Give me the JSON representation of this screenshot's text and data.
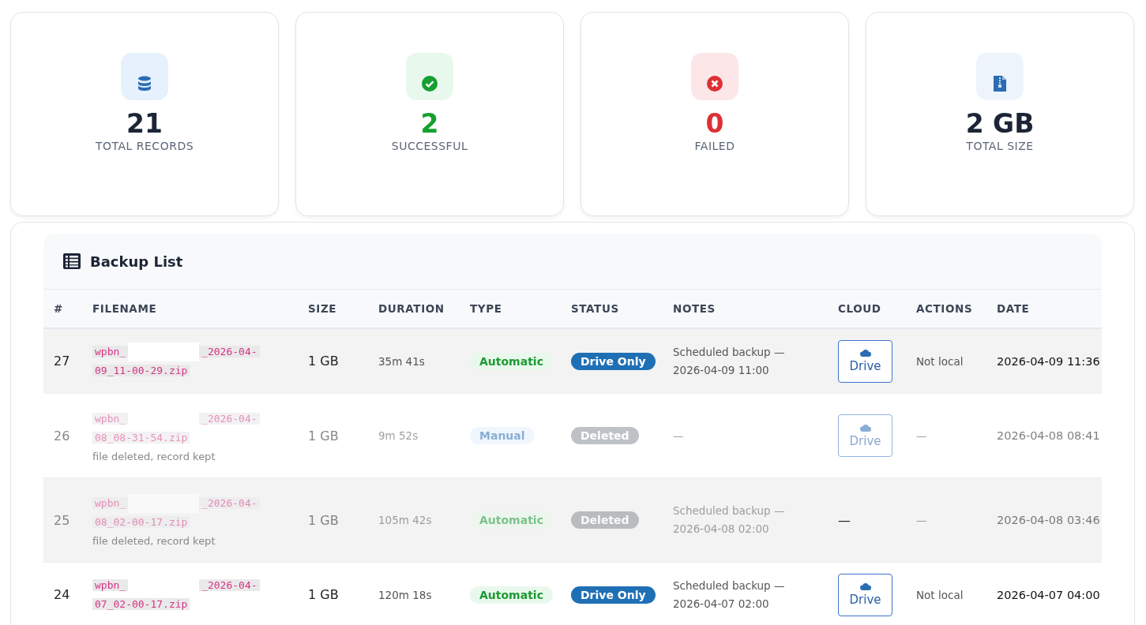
{
  "stats": [
    {
      "kind": "database",
      "value": "21",
      "label": "TOTAL RECORDS"
    },
    {
      "kind": "success",
      "value": "2",
      "label": "SUCCESSFUL"
    },
    {
      "kind": "failure",
      "value": "0",
      "label": "FAILED"
    },
    {
      "kind": "archive",
      "value": "2 GB",
      "label": "TOTAL SIZE"
    }
  ],
  "backup_list": {
    "title": "Backup List",
    "columns": [
      "#",
      "FILENAME",
      "SIZE",
      "DURATION",
      "TYPE",
      "STATUS",
      "NOTES",
      "CLOUD",
      "ACTIONS",
      "DATE"
    ],
    "rows": [
      {
        "number": "27",
        "filename_start": "wpbn_",
        "filename_end": "_2026-04-",
        "filename_line2": "09_11-00-29.zip",
        "deleted": false,
        "size": "1 GB",
        "duration": "35m 41s",
        "type": {
          "kind": "automatic",
          "label": "Automatic"
        },
        "status": {
          "kind": "drive",
          "label": "Drive Only"
        },
        "notes": [
          "Scheduled backup —",
          "2026-04-09 11:00"
        ],
        "cloud": {
          "kind": "drive",
          "label": "Drive"
        },
        "actions": "Not local",
        "date": "2026-04-09 11:36"
      },
      {
        "number": "26",
        "filename_start": "wpbn_",
        "filename_end": "_2026-04-",
        "filename_line2": "08_08-31-54.zip",
        "deleted": true,
        "deleted_note": "file deleted, record kept",
        "size": "1 GB",
        "duration": "9m 52s",
        "type": {
          "kind": "manual",
          "label": "Manual"
        },
        "status": {
          "kind": "deleted",
          "label": "Deleted"
        },
        "notes": [
          "—"
        ],
        "cloud": {
          "kind": "drive",
          "label": "Drive"
        },
        "actions": "—",
        "date": "2026-04-08 08:41"
      },
      {
        "number": "25",
        "filename_start": "wpbn_",
        "filename_end": "_2026-04-",
        "filename_line2": "08_02-00-17.zip",
        "deleted": true,
        "deleted_note": "file deleted, record kept",
        "size": "1 GB",
        "duration": "105m 42s",
        "type": {
          "kind": "automatic",
          "label": "Automatic"
        },
        "status": {
          "kind": "deleted",
          "label": "Deleted"
        },
        "notes": [
          "Scheduled backup —",
          "2026-04-08 02:00"
        ],
        "cloud": {
          "kind": "none",
          "label": "—"
        },
        "actions": "—",
        "date": "2026-04-08 03:46"
      },
      {
        "number": "24",
        "filename_start": "wpbn_",
        "filename_end": "_2026-04-",
        "filename_line2": "07_02-00-17.zip",
        "deleted": false,
        "size": "1 GB",
        "duration": "120m 18s",
        "type": {
          "kind": "automatic",
          "label": "Automatic"
        },
        "status": {
          "kind": "drive",
          "label": "Drive Only"
        },
        "notes": [
          "Scheduled backup —",
          "2026-04-07 02:00"
        ],
        "cloud": {
          "kind": "drive",
          "label": "Drive"
        },
        "actions": "Not local",
        "date": "2026-04-07 04:00"
      }
    ]
  }
}
